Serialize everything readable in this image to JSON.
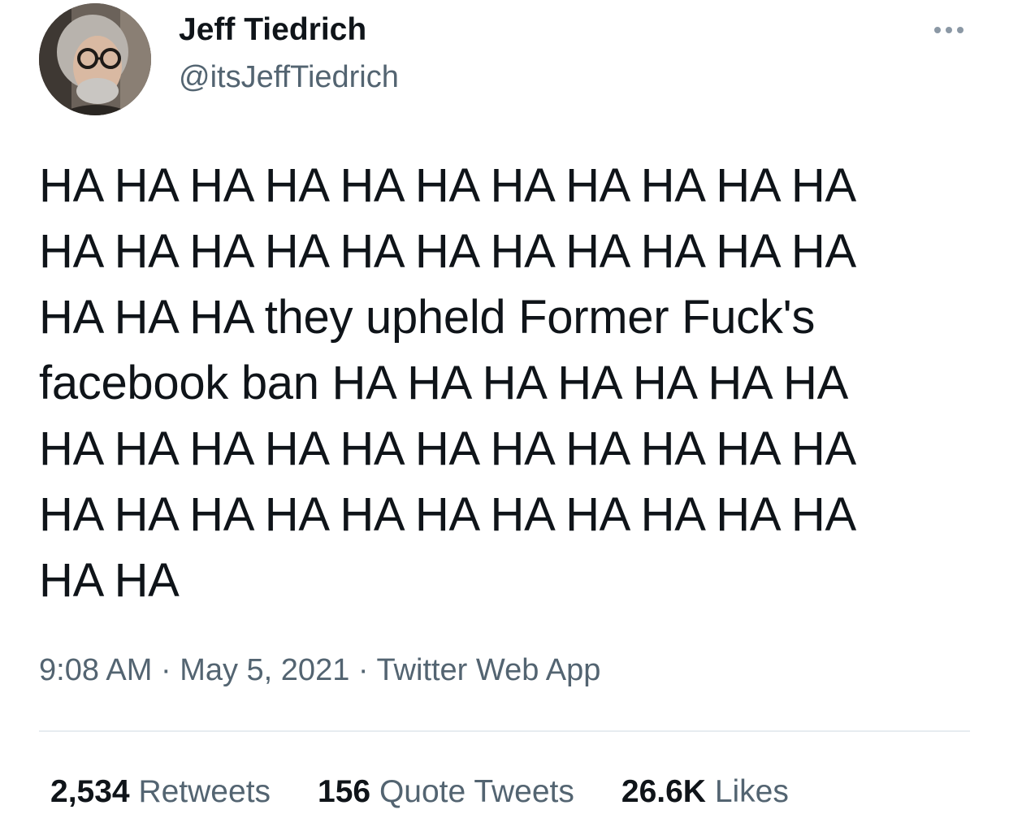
{
  "author": {
    "display_name": "Jeff Tiedrich",
    "handle": "@itsJeffTiedrich",
    "avatar_icon": "profile-photo"
  },
  "more_icon": "more-horizontal-icon",
  "tweet": {
    "text": "HA HA HA HA HA HA HA HA HA HA HA\nHA HA HA HA HA HA HA HA HA HA HA\nHA HA HA they upheld Former Fuck's\nfacebook ban HA HA HA HA HA HA HA\nHA HA HA HA HA HA HA HA HA HA HA\nHA HA HA HA HA HA HA HA HA HA HA\nHA HA"
  },
  "meta": {
    "time": "9:08 AM",
    "separator": " · ",
    "date": "May 5, 2021",
    "source": "Twitter Web App"
  },
  "stats": {
    "retweets_count": "2,534",
    "retweets_label": "Retweets",
    "quotes_count": "156",
    "quotes_label": "Quote Tweets",
    "likes_count": "26.6K",
    "likes_label": "Likes"
  },
  "colors": {
    "text_primary": "#0f1419",
    "text_secondary": "#536471",
    "divider": "#e7ecf0"
  }
}
